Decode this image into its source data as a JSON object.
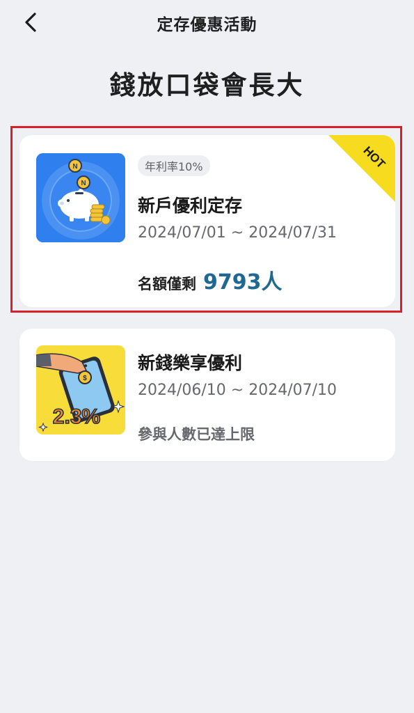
{
  "header": {
    "title": "定存優惠活動",
    "back_icon": "chevron-left-icon"
  },
  "page": {
    "heading": "錢放口袋會長大"
  },
  "colors": {
    "highlight": "#d8202a",
    "accent_number": "#1e6891",
    "hot_ribbon": "#f6db1e",
    "card1_thumb_bg": "#2f7fee",
    "card2_thumb_bg": "#f7dc3a"
  },
  "offers": [
    {
      "badge": "年利率10%",
      "title": "新戶優利定存",
      "date_range": "2024/07/01 ~ 2024/07/31",
      "quota_label": "名額僅剩",
      "quota_value": "9793人",
      "ribbon": "HOT",
      "icon": "piggy-bank-coins-icon"
    },
    {
      "title": "新錢樂享優利",
      "date_range": "2024/06/10 ~ 2024/07/10",
      "status": "參與人數已達上限",
      "image_text": "2.3%",
      "icon": "phone-coin-deposit-icon"
    }
  ]
}
